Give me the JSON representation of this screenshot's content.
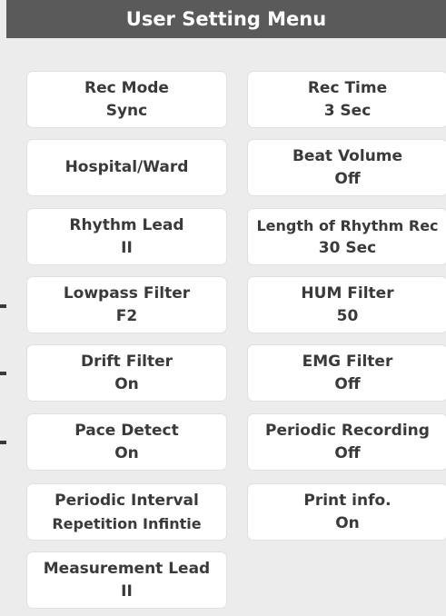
{
  "window": {
    "title": "User Setting Menu"
  },
  "settings": [
    {
      "label": "Rec Mode",
      "value": "Sync"
    },
    {
      "label": "Rec Time",
      "value": "3 Sec"
    },
    {
      "label": "Hospital/Ward",
      "value": ""
    },
    {
      "label": "Beat Volume",
      "value": "Off"
    },
    {
      "label": "Rhythm Lead",
      "value": "II"
    },
    {
      "label": "Length of Rhythm Rec",
      "value": "30 Sec"
    },
    {
      "label": "Lowpass Filter",
      "value": "F2"
    },
    {
      "label": "HUM Filter",
      "value": "50"
    },
    {
      "label": "Drift Filter",
      "value": "On"
    },
    {
      "label": "EMG Filter",
      "value": "Off"
    },
    {
      "label": "Pace Detect",
      "value": "On"
    },
    {
      "label": "Periodic Recording",
      "value": "Off"
    },
    {
      "label": "Periodic Interval",
      "value": "Repetition Infintie"
    },
    {
      "label": "Print info.",
      "value": "On"
    },
    {
      "label": "Measurement Lead",
      "value": "II"
    }
  ]
}
